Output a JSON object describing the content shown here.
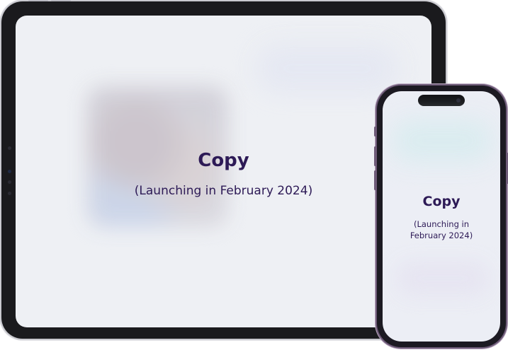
{
  "tablet": {
    "title": "Copy",
    "subtitle": "(Launching in February 2024)"
  },
  "phone": {
    "title": "Copy",
    "subtitle_line1": "(Launching in",
    "subtitle_line2": "February 2024)"
  },
  "colors": {
    "accent_text": "#2d1a56",
    "device_frame": "#1a1a1d",
    "phone_frame_accent": "#6e5b78",
    "screen_background": "#eef0f4"
  }
}
